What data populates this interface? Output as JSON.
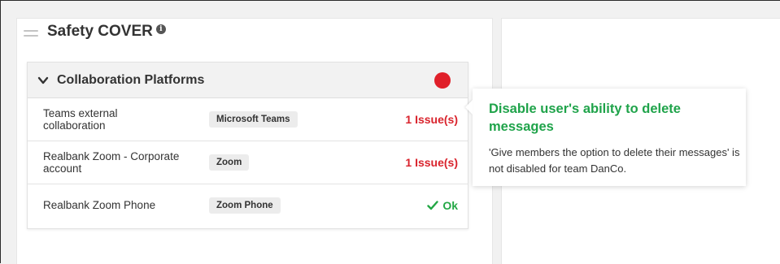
{
  "widget": {
    "title": "Safety COVER",
    "info_icon": "info-icon",
    "drag_icon": "drag-handle-icon"
  },
  "panel": {
    "title": "Collaboration Platforms",
    "status_color": "#e0202a",
    "rows": [
      {
        "name": "Teams external collaboration",
        "platform": "Microsoft Teams",
        "status": "1 Issue(s)",
        "status_type": "issue"
      },
      {
        "name": "Realbank Zoom - Corporate account",
        "platform": "Zoom",
        "status": "1 Issue(s)",
        "status_type": "issue"
      },
      {
        "name": "Realbank Zoom Phone",
        "platform": "Zoom Phone",
        "status": "Ok",
        "status_type": "ok"
      }
    ]
  },
  "tooltip": {
    "title": "Disable user's ability to delete messages",
    "body": "'Give members the option to delete their messages' is not disabled for team DanCo."
  },
  "colors": {
    "issue": "#d9232c",
    "ok": "#23a745",
    "tooltip_title": "#1fa34a"
  }
}
